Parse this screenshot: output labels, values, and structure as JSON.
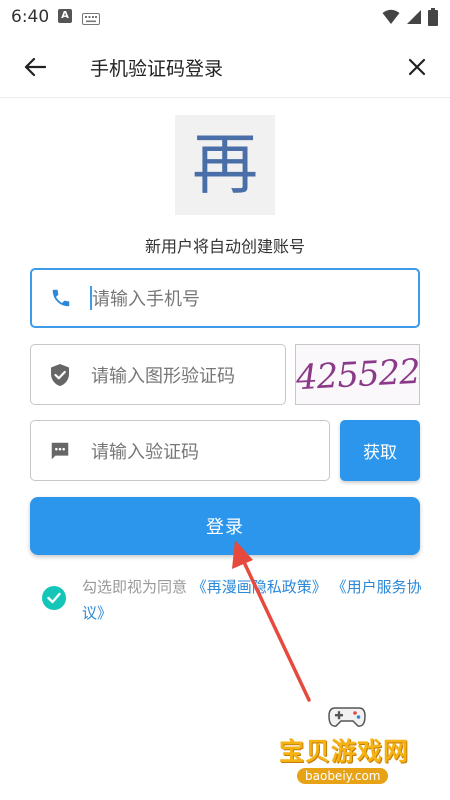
{
  "status_bar": {
    "time": "6:40",
    "notification_letter": "A"
  },
  "app_bar": {
    "title": "手机验证码登录"
  },
  "logo": {
    "char": "再"
  },
  "subtitle": "新用户将自动创建账号",
  "form": {
    "phone_placeholder": "请输入手机号",
    "captcha_placeholder": "请输入图形验证码",
    "captcha_image_text": "425522",
    "code_placeholder": "请输入验证码",
    "get_code_label": "获取",
    "login_label": "登录"
  },
  "agreement": {
    "prefix": "勾选即视为同意 ",
    "privacy_link": "《再漫画隐私政策》",
    "separator": " ",
    "service_link": "《用户服务协议》",
    "checked": true
  },
  "watermark": {
    "title": "宝贝游戏网",
    "domain": "baobeiy.com"
  },
  "colors": {
    "primary": "#2c96ec",
    "focus": "#3d9be9",
    "check": "#14c6b8",
    "arrow": "#e64a3f",
    "link": "#2c89d8"
  }
}
